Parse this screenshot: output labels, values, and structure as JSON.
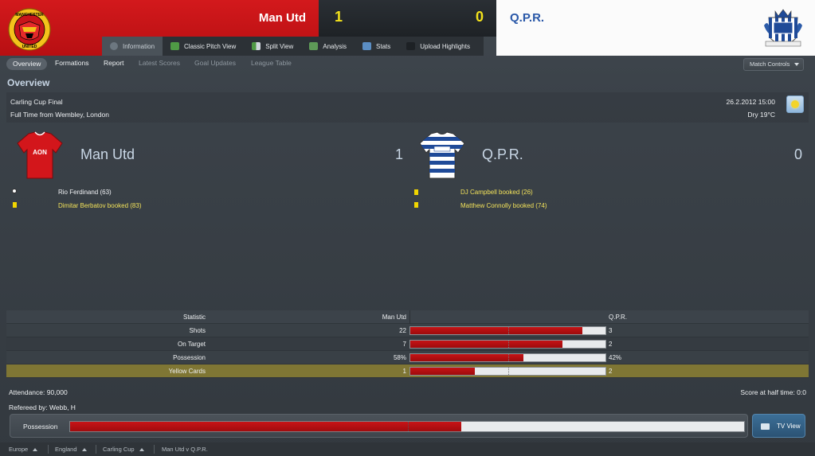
{
  "header": {
    "home_team": "Man Utd",
    "away_team": "Q.P.R.",
    "home_score": "1",
    "away_score": "0",
    "home_color": "#c8151a",
    "away_color": "#2a58a8",
    "score_color": "#f3e21b",
    "home_crest_text": [
      "MANCHESTER",
      "UNITED"
    ]
  },
  "tabs": [
    {
      "label": "Information",
      "icon": "info-icon",
      "active": true
    },
    {
      "label": "Classic Pitch View",
      "icon": "pitch-icon"
    },
    {
      "label": "Split View",
      "icon": "split-view-icon"
    },
    {
      "label": "Analysis",
      "icon": "analysis-icon"
    },
    {
      "label": "Stats",
      "icon": "stats-icon"
    },
    {
      "label": "Upload Highlights",
      "icon": "camera-icon"
    }
  ],
  "subnav": {
    "items": [
      "Overview",
      "Formations",
      "Report",
      "Latest Scores",
      "Goal Updates",
      "League Table"
    ],
    "active": "Overview",
    "match_controls": "Match Controls"
  },
  "overview": {
    "title": "Overview",
    "competition": "Carling Cup Final",
    "venue": "Full Time from Wembley, London",
    "datetime": "26.2.2012 15:00",
    "weather": "Dry 19°C",
    "weather_icon": "sunny-icon"
  },
  "home": {
    "name": "Man Utd",
    "goals": "1",
    "shirt_sponsor": "AON",
    "events": [
      {
        "type": "goal",
        "icon": "ball-icon",
        "text": "Rio Ferdinand (63)"
      },
      {
        "type": "booking",
        "icon": "yellow-card-icon",
        "text": "Dimitar Berbatov booked (83)"
      }
    ]
  },
  "away": {
    "name": "Q.P.R.",
    "goals": "0",
    "events": [
      {
        "type": "booking",
        "icon": "yellow-card-icon",
        "text": "DJ Campbell booked (26)"
      },
      {
        "type": "booking",
        "icon": "yellow-card-icon",
        "text": "Matthew Connolly booked (74)"
      }
    ]
  },
  "stats": {
    "header": {
      "label": "Statistic",
      "home": "Man Utd",
      "away": "Q.P.R."
    },
    "rows": [
      {
        "label": "Shots",
        "home": "22",
        "away": "3",
        "home_share": 0.88
      },
      {
        "label": "On Target",
        "home": "7",
        "away": "2",
        "home_share": 0.78
      },
      {
        "label": "Possession",
        "home": "58%",
        "away": "42%",
        "home_share": 0.58
      },
      {
        "label": "Yellow Cards",
        "home": "1",
        "away": "2",
        "home_share": 0.33,
        "highlighted": true
      }
    ]
  },
  "footer": {
    "attendance": "Attendance: 90,000",
    "referee": "Refereed by: Webb, H",
    "halftime": "Score at half time: 0:0",
    "possession_label": "Possession",
    "possession_home_share": 0.58,
    "tv_view": "TV View"
  },
  "breadcrumb": [
    "Europe",
    "England",
    "Carling Cup",
    "Man Utd v Q.P.R."
  ]
}
